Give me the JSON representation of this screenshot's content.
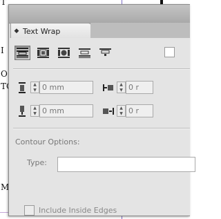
{
  "background_document": {
    "fragments": [
      "T",
      "I",
      "O",
      "TC",
      "M"
    ]
  },
  "panel": {
    "title": "Text Wrap",
    "tab_menu_icon": "diamond-arrows-icon",
    "wrap_options": [
      {
        "name": "no-text-wrap",
        "icon": "no-wrap-icon",
        "selected": true
      },
      {
        "name": "wrap-around-bounding-box",
        "icon": "bounding-box-wrap-icon",
        "selected": false
      },
      {
        "name": "wrap-around-object-shape",
        "icon": "object-shape-wrap-icon",
        "selected": false
      },
      {
        "name": "jump-object",
        "icon": "jump-object-icon",
        "selected": false
      },
      {
        "name": "jump-to-next-column",
        "icon": "jump-column-icon",
        "selected": false
      }
    ],
    "offsets": {
      "top": "0 mm",
      "bottom": "0 mm",
      "left": "0 r",
      "right": "0 r"
    },
    "contour_options_label": "Contour Options:",
    "type_label": "Type:",
    "type_value": "",
    "include_inside_edges_label": "Include Inside Edges"
  }
}
